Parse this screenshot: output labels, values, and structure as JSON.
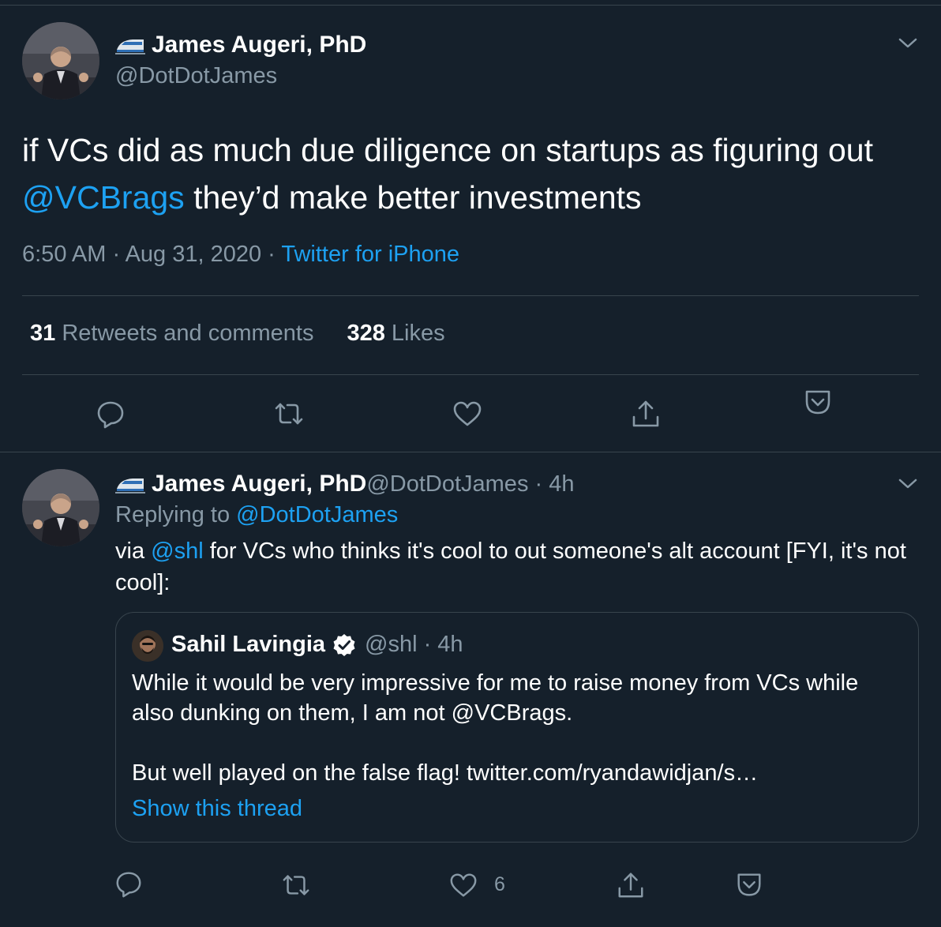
{
  "main_tweet": {
    "display_name": "James Augeri, PhD",
    "handle": "@DotDotJames",
    "text_parts": {
      "before": "if VCs did as much due diligence on startups as figuring out ",
      "mention": "@VCBrags",
      "after": " they’d make better investments"
    },
    "time": "6:50 AM · Aug 31, 2020 · ",
    "source": "Twitter for iPhone",
    "stats": {
      "retweets_count": "31",
      "retweets_label": " Retweets and comments",
      "likes_count": "328",
      "likes_label": " Likes"
    },
    "actions": [
      "reply-icon",
      "retweet-icon",
      "like-icon",
      "share-icon",
      "pocket-icon"
    ]
  },
  "reply_tweet": {
    "display_name": "James Augeri, PhD",
    "handle_time": " @DotDotJames · 4h",
    "replying_label": "Replying to ",
    "replying_to": "@DotDotJames",
    "text_parts": {
      "before": "via ",
      "mention": "@shl",
      "after": " for VCs who thinks it's cool to out someone's alt account [FYI, it's not cool]:"
    },
    "quote": {
      "name": "Sahil Lavingia",
      "handle_time": "@shl · 4h",
      "paragraph1": "While it would be very impressive for me to raise money from VCs while also dunking on them, I am not @VCBrags.",
      "paragraph2": "But well played on the false flag! twitter.com/ryandawidjan/s…",
      "show_thread": "Show this thread"
    },
    "like_count": "6"
  },
  "colors": {
    "background": "#15202b",
    "border": "#38444d",
    "secondary_text": "#8899a6",
    "accent": "#1da1f2",
    "text": "#ffffff"
  }
}
